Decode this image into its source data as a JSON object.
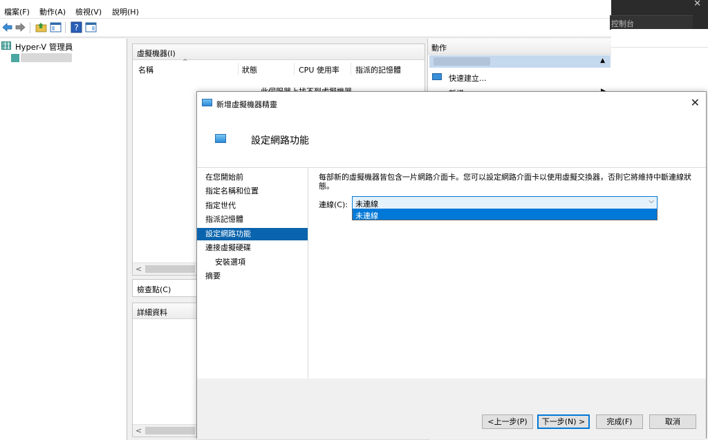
{
  "menubar": {
    "items": [
      "檔案(F)",
      "動作(A)",
      "檢視(V)",
      "說明(H)"
    ]
  },
  "tree": {
    "root_label": "Hyper-V 管理員"
  },
  "vm_pane": {
    "title": "虛擬機器(I)",
    "columns": [
      "名稱",
      "狀態",
      "CPU 使用率",
      "指派的記憶體"
    ],
    "empty_message": "此伺服器上找不到虛擬機器。"
  },
  "checkpoint_pane": {
    "title": "檢查點(C)"
  },
  "details_pane": {
    "title": "詳細資料"
  },
  "actions_pane": {
    "title": "動作",
    "items": [
      "快速建立...",
      "新增"
    ]
  },
  "dark_app": {
    "tab_label": "控制台",
    "close_glyph": "✕"
  },
  "wizard": {
    "title": "新增虛擬機器精靈",
    "heading": "設定網路功能",
    "close_glyph": "✕",
    "steps": [
      {
        "label": "在您開始前",
        "sub": false,
        "active": false
      },
      {
        "label": "指定名稱和位置",
        "sub": false,
        "active": false
      },
      {
        "label": "指定世代",
        "sub": false,
        "active": false
      },
      {
        "label": "指派記憶體",
        "sub": false,
        "active": false
      },
      {
        "label": "設定網路功能",
        "sub": false,
        "active": true
      },
      {
        "label": "連接虛擬硬碟",
        "sub": false,
        "active": false
      },
      {
        "label": "安裝選項",
        "sub": true,
        "active": false
      },
      {
        "label": "摘要",
        "sub": false,
        "active": false
      }
    ],
    "description": "每部新的虛擬機器皆包含一片網路介面卡。您可以設定網路介面卡以使用虛擬交換器，否則它將維持中斷連線狀態。",
    "connection_label": "連線(C):",
    "connection_value": "未連線",
    "dropdown_options": [
      "未連線"
    ],
    "buttons": {
      "prev": "<上一步(P)",
      "next": "下一步(N) >",
      "finish": "完成(F)",
      "cancel": "取消"
    }
  },
  "colors": {
    "selection_blue": "#0078d7",
    "step_active": "#0a64ad",
    "action_highlight": "#c4d8ee"
  }
}
